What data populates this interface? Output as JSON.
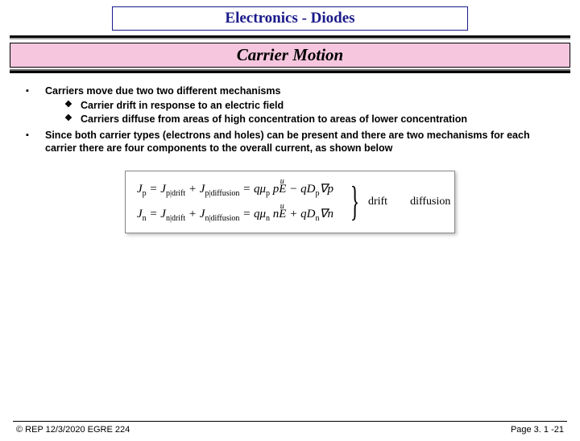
{
  "header": {
    "title": "Electronics - Diodes",
    "subtitle": "Carrier Motion"
  },
  "bullets": {
    "b1": "Carriers move due two two different mechanisms",
    "b1a": "Carrier drift in response to an electric field",
    "b1b": "Carriers diffuse from areas of high concentration to areas of lower concentration",
    "b2": "Since both carrier types (electrons and holes) can be present and there are two mechanisms for each carrier there are four components to the overall current, as shown below"
  },
  "equations": {
    "jp_lhs": "J",
    "jp_sub": "p",
    "jp_eq": " = J",
    "jp_drift_sub": "p|drift",
    "jp_plus": " + J",
    "jp_diff_sub": "p|diffusion",
    "jp_rhs1": " = qμ",
    "jp_mu_sub": "p",
    "jp_p": "p",
    "jp_E": "E",
    "jp_minus": " − qD",
    "jp_D_sub": "p",
    "jp_grad": "∇p",
    "jn_lhs": "J",
    "jn_sub": "n",
    "jn_eq": " = J",
    "jn_drift_sub": "n|drift",
    "jn_plus": " + J",
    "jn_diff_sub": "n|diffusion",
    "jn_rhs1": " = qμ",
    "jn_mu_sub": "n",
    "jn_n": "n",
    "jn_E": "E",
    "jn_plus2": " + qD",
    "jn_D_sub": "n",
    "jn_grad": "∇n",
    "label_drift": "drift",
    "label_diff": "diffusion"
  },
  "footer": {
    "left": "© REP  12/3/2020  EGRE 224",
    "right": "Page 3. 1 -21"
  }
}
